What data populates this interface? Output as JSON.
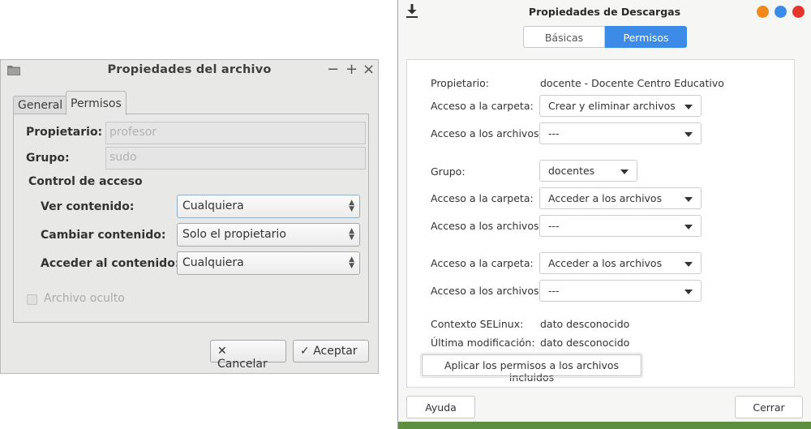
{
  "left_dialog": {
    "title": "Propiedades del archivo",
    "window_controls": {
      "minimize": "−",
      "maximize": "+",
      "close": "×"
    },
    "tabs": [
      {
        "label": "General",
        "active": false
      },
      {
        "label": "Permisos",
        "active": true
      }
    ],
    "owner": {
      "label": "Propietario:",
      "value": "profesor"
    },
    "group": {
      "label": "Grupo:",
      "value": "sudo"
    },
    "access_control_heading": "Control de acceso",
    "view_content": {
      "label": "Ver contenido:",
      "value": "Cualquiera"
    },
    "change_content": {
      "label": "Cambiar contenido:",
      "value": "Solo el propietario"
    },
    "access_content": {
      "label": "Acceder al contenido:",
      "value": "Cualquiera"
    },
    "hidden_file": {
      "label": "Archivo oculto",
      "checked": false
    },
    "cancel_label": "Cancelar",
    "accept_label": "Aceptar",
    "icons": {
      "window": "folder-icon",
      "cancel": "x-icon",
      "accept": "checkmark-icon"
    }
  },
  "right_dialog": {
    "title": "Propiedades de Descargas",
    "window_buttons": [
      {
        "name": "minimize",
        "color": "#f08a1c"
      },
      {
        "name": "maximize",
        "color": "#3c8ce7"
      },
      {
        "name": "close",
        "color": "#e6352c"
      }
    ],
    "tabs": [
      {
        "label": "Básicas",
        "active": false
      },
      {
        "label": "Permisos",
        "active": true
      }
    ],
    "owner": {
      "label": "Propietario:",
      "value": "docente - Docente Centro Educativo"
    },
    "owner_folder_access": {
      "label": "Acceso a la carpeta:",
      "value": "Crear y eliminar archivos"
    },
    "owner_file_access": {
      "label": "Acceso a los archivos:",
      "value": "---"
    },
    "group": {
      "label": "Grupo:",
      "value": "docentes"
    },
    "group_folder_access": {
      "label": "Acceso a la carpeta:",
      "value": "Acceder a los archivos"
    },
    "group_file_access": {
      "label": "Acceso a los archivos:",
      "value": "---"
    },
    "others_folder_access": {
      "label": "Acceso a la carpeta:",
      "value": "Acceder a los archivos"
    },
    "others_file_access": {
      "label": "Acceso a los archivos:",
      "value": "---"
    },
    "selinux": {
      "label": "Contexto SELinux:",
      "value": "dato desconocido"
    },
    "last_modified": {
      "label": "Última modificación:",
      "value": "dato desconocido"
    },
    "apply_button": "Aplicar los permisos a los archivos incluidos",
    "help_button": "Ayuda",
    "close_button": "Cerrar",
    "accent_color": "#3c8ce7",
    "icons": {
      "window": "download-icon"
    }
  }
}
